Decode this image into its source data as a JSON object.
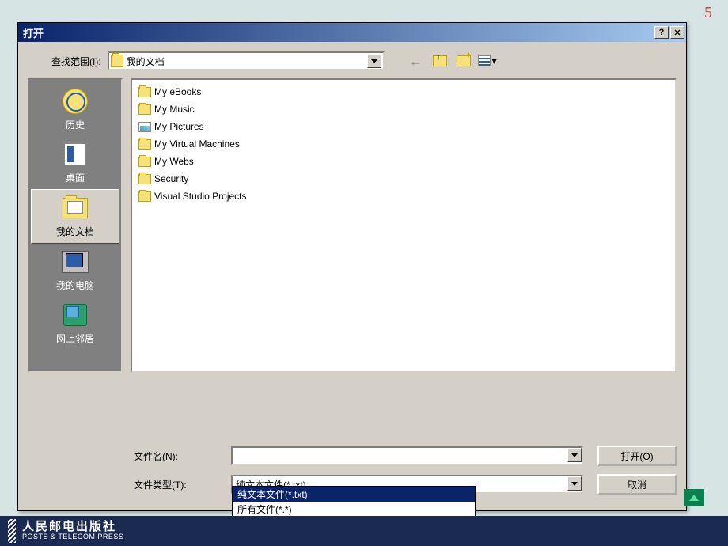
{
  "page_number": "5",
  "dialog": {
    "title": "打开",
    "lookin_label": "查找范围(I):",
    "lookin_value": "我的文档",
    "toolbar": {
      "back": "back-arrow",
      "up": "up-folder",
      "new": "new-folder",
      "views": "views-menu"
    }
  },
  "places": [
    {
      "label": "历史",
      "icon": "history"
    },
    {
      "label": "桌面",
      "icon": "desktop"
    },
    {
      "label": "我的文档",
      "icon": "mydocs",
      "selected": true
    },
    {
      "label": "我的电脑",
      "icon": "computer"
    },
    {
      "label": "网上邻居",
      "icon": "network"
    }
  ],
  "files": [
    {
      "name": "My eBooks",
      "type": "folder"
    },
    {
      "name": "My Music",
      "type": "folder"
    },
    {
      "name": "My Pictures",
      "type": "pictures"
    },
    {
      "name": "My Virtual Machines",
      "type": "folder"
    },
    {
      "name": "My Webs",
      "type": "folder"
    },
    {
      "name": "Security",
      "type": "folder"
    },
    {
      "name": "Visual Studio Projects",
      "type": "folder"
    }
  ],
  "filename_label": "文件名(N):",
  "filename_value": "",
  "filetype_label": "文件类型(T):",
  "filetype_value": "纯文本文件(*.txt)",
  "filetype_options": [
    "纯文本文件(*.txt)",
    "所有文件(*.*)"
  ],
  "buttons": {
    "open": "打开(O)",
    "cancel": "取消"
  },
  "footer": {
    "publisher_cn": "人民邮电出版社",
    "publisher_en": "POSTS & TELECOM PRESS"
  }
}
